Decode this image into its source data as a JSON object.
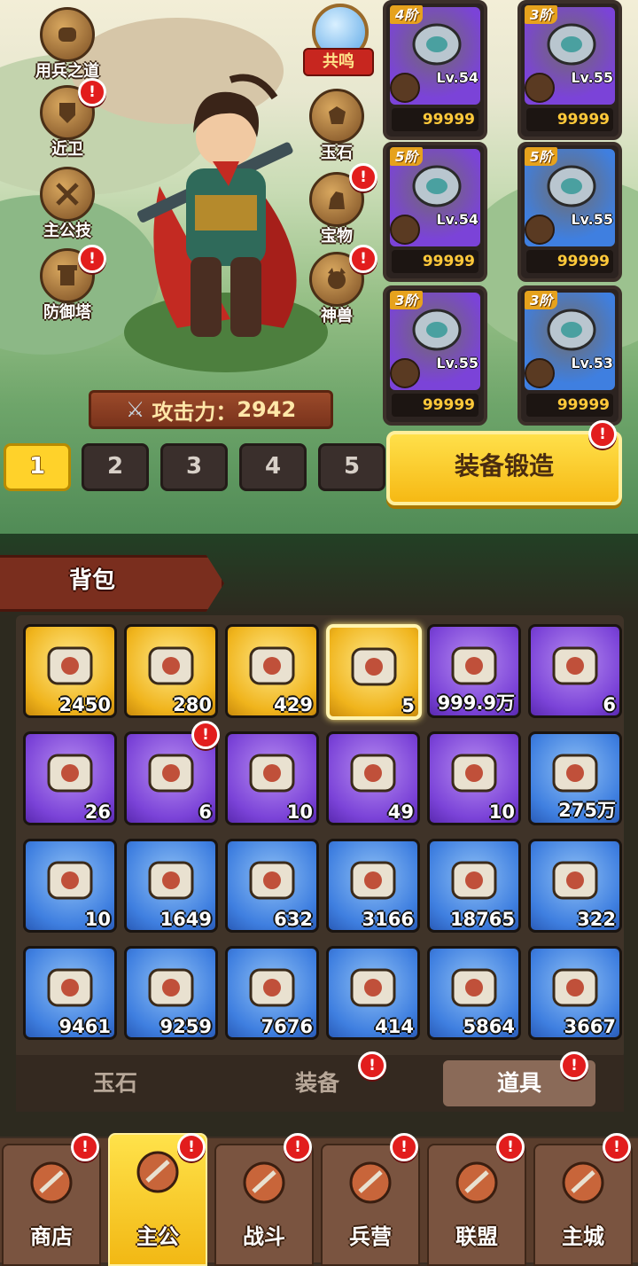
{
  "left_menu": [
    {
      "key": "art_of_war",
      "label": "用兵之道",
      "alert": false
    },
    {
      "key": "guards",
      "label": "近卫",
      "alert": true
    },
    {
      "key": "lord_skill",
      "label": "主公技",
      "alert": false
    },
    {
      "key": "tower",
      "label": "防御塔",
      "alert": true
    }
  ],
  "right_menu": [
    {
      "key": "resonance",
      "label": "共鸣",
      "alert": false
    },
    {
      "key": "jade",
      "label": "玉石",
      "alert": false
    },
    {
      "key": "treasure",
      "label": "宝物",
      "alert": true
    },
    {
      "key": "beast",
      "label": "神兽",
      "alert": true
    }
  ],
  "alert_mark": "!",
  "power": {
    "label": "攻击力：",
    "value": "2942"
  },
  "equipment": [
    {
      "tier": "4阶",
      "level": "Lv.54",
      "stars": "99999",
      "color": "#7b43d8"
    },
    {
      "tier": "3阶",
      "level": "Lv.55",
      "stars": "99999",
      "color": "#7b43d8"
    },
    {
      "tier": "5阶",
      "level": "Lv.54",
      "stars": "99999",
      "color": "#7b43d8"
    },
    {
      "tier": "5阶",
      "level": "Lv.55",
      "stars": "99999",
      "color": "#3f7fe0"
    },
    {
      "tier": "3阶",
      "level": "Lv.55",
      "stars": "99999",
      "color": "#7b43d8"
    },
    {
      "tier": "3阶",
      "level": "Lv.53",
      "stars": "99999",
      "color": "#3f7fe0"
    }
  ],
  "preset_tabs": [
    "1",
    "2",
    "3",
    "4",
    "5"
  ],
  "active_preset": "1",
  "forge_button": "装备锻造",
  "bag_title": "背包",
  "items": [
    {
      "name": "dragon-orb-icon",
      "count": "2450",
      "rarity": "gold"
    },
    {
      "name": "mortar-icon",
      "count": "280",
      "rarity": "gold"
    },
    {
      "name": "blue-gem-icon",
      "count": "429",
      "rarity": "gold"
    },
    {
      "name": "coin-stack-icon",
      "count": "5",
      "rarity": "gold",
      "selected": true
    },
    {
      "name": "gold-ingot-icon",
      "count": "999.9万",
      "rarity": "purple"
    },
    {
      "name": "gold-key-icon",
      "count": "6",
      "rarity": "purple"
    },
    {
      "name": "wine-jar-icon",
      "count": "26",
      "rarity": "purple"
    },
    {
      "name": "jade-shards-icon",
      "count": "6",
      "rarity": "purple",
      "alert": true
    },
    {
      "name": "red-carp-icon",
      "count": "10",
      "rarity": "purple"
    },
    {
      "name": "red-puzzle-icon",
      "count": "49",
      "rarity": "purple"
    },
    {
      "name": "blue-puzzle-icon",
      "count": "10",
      "rarity": "purple"
    },
    {
      "name": "copper-coin-icon",
      "count": "275万",
      "rarity": "blue"
    },
    {
      "name": "silver-key-icon",
      "count": "10",
      "rarity": "blue"
    },
    {
      "name": "scroll-bow-icon",
      "count": "1649",
      "rarity": "blue"
    },
    {
      "name": "scroll-sword-icon",
      "count": "632",
      "rarity": "blue"
    },
    {
      "name": "scroll-axe-icon",
      "count": "3166",
      "rarity": "blue"
    },
    {
      "name": "scroll-cross-icon",
      "count": "18765",
      "rarity": "blue"
    },
    {
      "name": "scroll-horse-icon",
      "count": "322",
      "rarity": "blue"
    },
    {
      "name": "scroll-horse-red-icon",
      "count": "9461",
      "rarity": "blue"
    },
    {
      "name": "scroll-blade-icon",
      "count": "9259",
      "rarity": "blue"
    },
    {
      "name": "scroll-fist-icon",
      "count": "7676",
      "rarity": "blue"
    },
    {
      "name": "scroll-fire-icon",
      "count": "414",
      "rarity": "blue"
    },
    {
      "name": "scroll-lightning-icon",
      "count": "5864",
      "rarity": "blue"
    },
    {
      "name": "scroll-swirl-icon",
      "count": "3667",
      "rarity": "blue"
    }
  ],
  "bag_tabs": [
    {
      "label": "玉石",
      "alert": false
    },
    {
      "label": "装备",
      "alert": true
    },
    {
      "label": "道具",
      "alert": true,
      "active": true
    }
  ],
  "nav": [
    {
      "key": "shop",
      "label": "商店",
      "alert": true
    },
    {
      "key": "lord",
      "label": "主公",
      "alert": true,
      "active": true
    },
    {
      "key": "battle",
      "label": "战斗",
      "alert": true
    },
    {
      "key": "barracks",
      "label": "兵营",
      "alert": true
    },
    {
      "key": "alliance",
      "label": "联盟",
      "alert": true
    },
    {
      "key": "city",
      "label": "主城",
      "alert": true
    }
  ],
  "colors": {
    "gold": "#f0b41c",
    "purple": "#7b43d8",
    "blue": "#3f7fe0",
    "alert": "#e21d1d",
    "star_red": "#ff4a3a",
    "star_gold": "#ffc93a"
  }
}
